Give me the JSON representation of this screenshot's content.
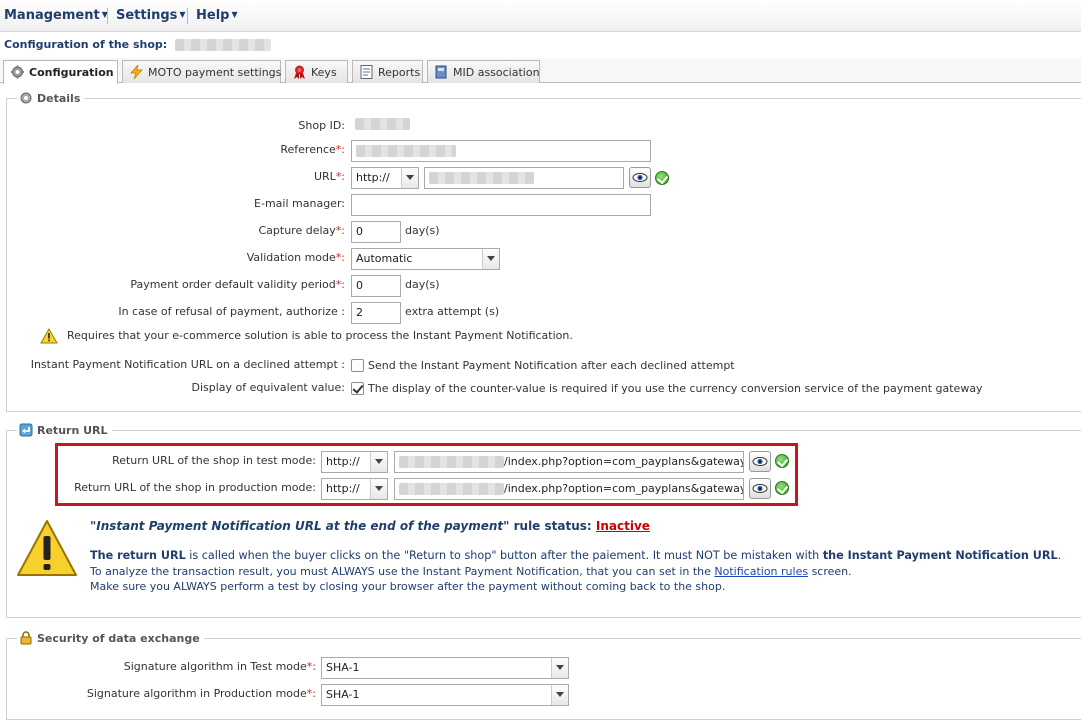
{
  "menu": {
    "management": "Management",
    "settings": "Settings",
    "help": "Help"
  },
  "shop_title": "Configuration of the shop:",
  "tabs": [
    {
      "label": "Configuration",
      "icon": "gear-icon"
    },
    {
      "label": "MOTO payment settings",
      "icon": "lightning-icon"
    },
    {
      "label": "Keys",
      "icon": "ribbon-icon"
    },
    {
      "label": "Reports",
      "icon": "report-icon"
    },
    {
      "label": "MID association",
      "icon": "book-icon"
    }
  ],
  "details": {
    "legend": "Details",
    "shop_id_label": "Shop ID:",
    "reference_label": "Reference",
    "url_label": "URL",
    "url_protocol": "http://",
    "email_label": "E-mail manager:",
    "capture_delay_label": "Capture delay",
    "capture_delay_value": "0",
    "capture_delay_unit": "day(s)",
    "validation_mode_label": "Validation mode",
    "validation_mode_value": "Automatic",
    "validity_label": "Payment order default validity period",
    "validity_value": "0",
    "validity_unit": "day(s)",
    "refusal_label": "In case of refusal of payment, authorize :",
    "refusal_value": "2",
    "refusal_unit": "extra attempt (s)",
    "warning_text": "Requires that your e-commerce solution is able to process the Instant Payment Notification.",
    "ipn_declined_label": "Instant Payment Notification URL on a declined attempt :",
    "ipn_declined_text": "Send the Instant Payment Notification after each declined attempt",
    "equiv_label": "Display of equivalent value:",
    "equiv_text": "The display of the counter-value is required if you use the currency conversion service of the payment gateway",
    "required_mark": "*:",
    "colon": ":"
  },
  "return_url": {
    "legend": "Return URL",
    "test_label": "Return URL of the shop in test mode:",
    "test_protocol": "http://",
    "test_value": "/index.php?option=com_payplans&gateway",
    "prod_label": "Return URL of the shop in production mode:",
    "prod_protocol": "http://",
    "prod_value": "/index.php?option=com_payplans&gateway",
    "rule_prefix": "\"",
    "rule_name": "Instant Payment Notification URL at the end of the payment",
    "rule_suffix": "\" rule status:",
    "rule_status": "Inactive",
    "info_bold1": "The return URL",
    "info_line1_mid": " is called when the buyer clicks on the \"Return to shop\" button after the paiement. It must NOT be mistaken with ",
    "info_bold2": "the Instant Payment Notification URL",
    "info_line1_end": ".",
    "info_line2_pre": "To analyze the transaction result, you must ALWAYS use the Instant Payment Notification, that you can set in the ",
    "info_link": "Notification rules",
    "info_line2_post": " screen.",
    "info_line3": "Make sure you ALWAYS perform a test by closing your browser after the payment without coming back to the shop."
  },
  "security": {
    "legend": "Security of data exchange",
    "test_algo_label": "Signature algorithm in Test mode",
    "test_algo_value": "SHA-1",
    "prod_algo_label": "Signature algorithm in Production mode",
    "prod_algo_value": "SHA-1"
  },
  "colors": {
    "nav_blue": "#1f3e6d",
    "required_red": "#e02020",
    "highlight_red": "#c8161d",
    "inactive_red": "#cc0000",
    "ok_green": "#2e9a1f"
  }
}
